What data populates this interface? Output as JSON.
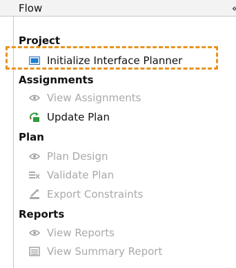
{
  "panel": {
    "title": "Flow",
    "collapse_glyph": "«"
  },
  "sections": {
    "project": {
      "label": "Project",
      "items": [
        {
          "label": "Initialize Interface Planner",
          "icon": "initialize-icon",
          "enabled": true
        }
      ]
    },
    "assignments": {
      "label": "Assignments",
      "items": [
        {
          "label": "View Assignments",
          "icon": "eye-icon",
          "enabled": false
        },
        {
          "label": "Update Plan",
          "icon": "update-plan-icon",
          "enabled": true
        }
      ]
    },
    "plan": {
      "label": "Plan",
      "items": [
        {
          "label": "Plan Design",
          "icon": "eye-icon",
          "enabled": false
        },
        {
          "label": "Validate Plan",
          "icon": "validate-icon",
          "enabled": false
        },
        {
          "label": "Export Constraints",
          "icon": "export-icon",
          "enabled": false
        }
      ]
    },
    "reports": {
      "label": "Reports",
      "items": [
        {
          "label": "View Reports",
          "icon": "eye-icon",
          "enabled": false
        },
        {
          "label": "View Summary Report",
          "icon": "summary-report-icon",
          "enabled": false
        }
      ]
    }
  },
  "colors": {
    "highlight": "#e6941f",
    "disabled_text": "#a9a9a9",
    "accent_blue": "#1e7fd1"
  }
}
